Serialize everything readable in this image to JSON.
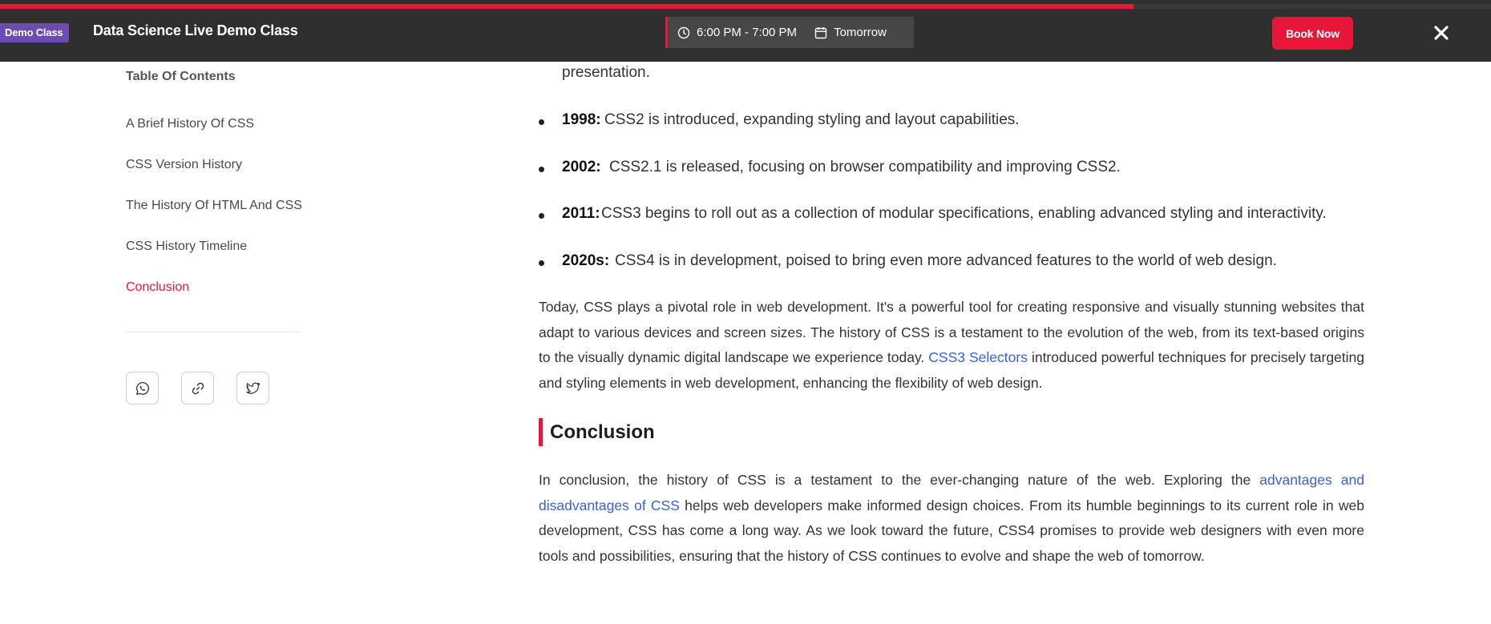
{
  "banner": {
    "badge": "Demo Class",
    "title": "Data Science Live Demo Class",
    "time": "6:00 PM - 7:00 PM",
    "day": "Tomorrow",
    "book_label": "Book Now",
    "progress_fraction": 0.76,
    "colors": {
      "accent": "#e8173a",
      "badge": "#6c4bb3",
      "bar": "#2f2f2f"
    }
  },
  "sidebar": {
    "heading": "Table Of Contents",
    "items": [
      {
        "label": "A Brief History Of CSS",
        "active": false
      },
      {
        "label": "CSS Version History",
        "active": false
      },
      {
        "label": "The History Of HTML And CSS",
        "active": false
      },
      {
        "label": "CSS History Timeline",
        "active": false
      },
      {
        "label": "Conclusion",
        "active": true
      }
    ],
    "share_icons": [
      "whatsapp-icon",
      "link-icon",
      "twitter-icon"
    ]
  },
  "content": {
    "continued_text": "presentation.",
    "timeline": [
      {
        "year": "1998:",
        "text": "CSS2 is introduced, expanding styling and layout capabilities."
      },
      {
        "year": "2002:",
        "text": "CSS2.1 is released, focusing on browser compatibility and improving CSS2."
      },
      {
        "year": "2011:",
        "text": "CSS3 begins to roll out as a collection of modular specifications, enabling advanced styling and interactivity."
      },
      {
        "year": "2020s:",
        "text": "CSS4 is in development, poised to bring even more advanced features to the world of web design."
      }
    ],
    "today_para": {
      "before_link": "Today, CSS plays a pivotal role in web development. It's a powerful tool for creating responsive and visually stunning websites that adapt to various devices and screen sizes. The history of CSS is a testament to the evolution of the web, from its text-based origins to the visually dynamic digital landscape we experience today. ",
      "link": "CSS3 Selectors",
      "after_link": " introduced powerful techniques for precisely targeting and styling elements in web development, enhancing the flexibility of web design."
    },
    "conclusion_heading": "Conclusion",
    "conclusion_para": {
      "before_link": "In conclusion, the history of CSS is a testament to the ever-changing nature of the web. Exploring the ",
      "link": "advantages and disadvantages of CSS",
      "after_link": " helps web developers make informed design choices. From its humble beginnings to its current role in web development, CSS has come a long way. As we look toward the future, CSS4 promises to provide web designers with even more tools and possibilities, ensuring that the history of CSS continues to evolve and shape the web of tomorrow."
    }
  }
}
